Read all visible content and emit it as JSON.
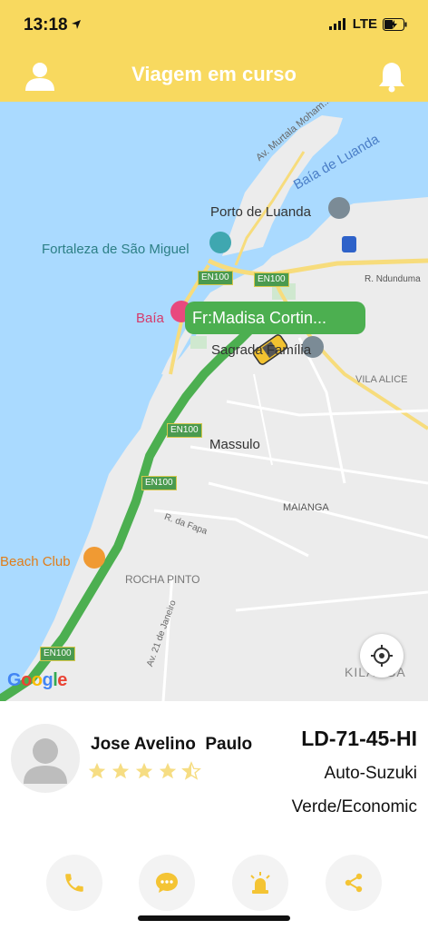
{
  "status": {
    "time": "13:18",
    "network": "LTE"
  },
  "header": {
    "title": "Viagem em curso",
    "left_icon": "user-icon",
    "right_icon": "bell-icon"
  },
  "map": {
    "labels": {
      "av_murtala": "Av. Murtala Moham...",
      "baia_luanda": "Baía de Luanda",
      "porto": "Porto de Luanda",
      "fortaleza": "Fortaleza de São Miguel",
      "baia": "Baía",
      "sagrada": "Sagrada Família",
      "r_ndunduma": "R. Ndunduma",
      "vila_alice": "VILA ALICE",
      "massulo": "Massulo",
      "maianga": "MAIANGA",
      "r_fapa": "R. da Fapa",
      "beach_club": "Beach Club",
      "rocha_pinto": "ROCHA PINTO",
      "av_21": "Av. 21 de Janeiro",
      "kilamba": "KILAMBA",
      "en100": "EN100"
    },
    "origin_bubble": "Fr:Madisa Cortin...",
    "google": "Google"
  },
  "driver": {
    "name": "Jose Avelino  Paulo",
    "rating": 4.5,
    "plate": "LD-71-45-HI",
    "car_model": "Auto-Suzuki",
    "car_color": "Verde/Economic"
  },
  "actions": [
    "phone-icon",
    "chat-icon",
    "alarm-icon",
    "share-icon"
  ],
  "colors": {
    "accent": "#f8d95f",
    "route": "#4caf50",
    "water": "#aadaff"
  }
}
